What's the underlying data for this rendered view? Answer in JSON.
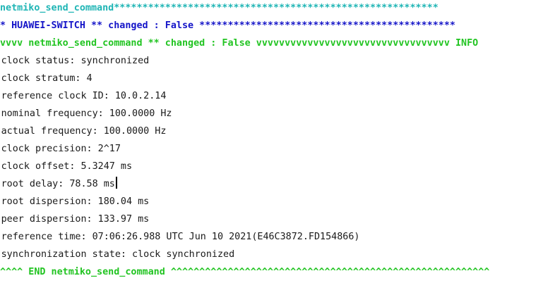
{
  "colors": {
    "task_header": "#1fb5b5",
    "host_header": "#1414c8",
    "result_header": "#22c422",
    "output_text": "#1a1a1a",
    "background": "#ffffff"
  },
  "terminal": {
    "task_header": "netmiko_send_command*********************************************************",
    "host_header": "* HUAWEI-SWITCH ** changed : False *********************************************",
    "result_header": "vvvv netmiko_send_command ** changed : False vvvvvvvvvvvvvvvvvvvvvvvvvvvvvvvvvv INFO",
    "output_lines": [
      "clock status: synchronized",
      "clock stratum: 4",
      "reference clock ID: 10.0.2.14",
      "nominal frequency: 100.0000 Hz",
      "actual frequency: 100.0000 Hz",
      "clock precision: 2^17",
      "clock offset: 5.3247 ms",
      "root delay: 78.58 ms",
      "root dispersion: 180.04 ms",
      "peer dispersion: 133.97 ms",
      "reference time: 07:06:26.988 UTC Jun 10 2021(E46C3872.FD154866)",
      "synchronization state: clock synchronized"
    ],
    "footer": "^^^^ END netmiko_send_command ^^^^^^^^^^^^^^^^^^^^^^^^^^^^^^^^^^^^^^^^^^^^^^^^^^^^^^^^"
  }
}
